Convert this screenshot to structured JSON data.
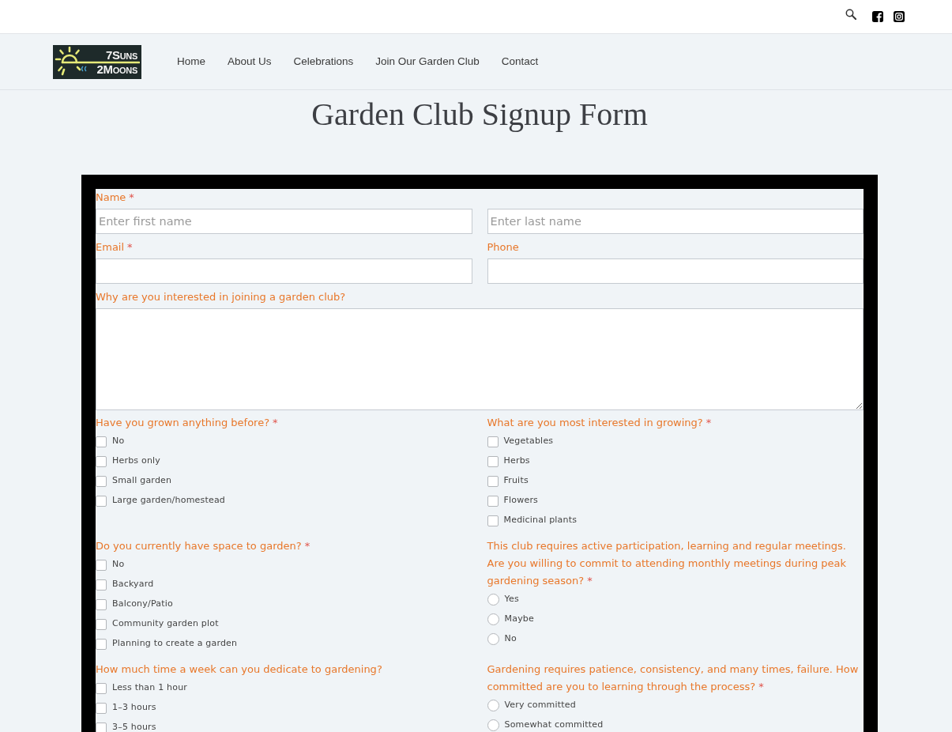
{
  "header": {
    "logo": {
      "line_1": "7Suns",
      "line_2": "2Moons"
    },
    "nav": [
      "Home",
      "About Us",
      "Celebrations",
      "Join Our Garden Club",
      "Contact"
    ]
  },
  "page_title": "Garden Club Signup Form",
  "form": {
    "rows": [
      {
        "columns": [
          {
            "kind": "text",
            "label": "Name",
            "required_mark": "*",
            "placeholder": "Enter first name"
          },
          {
            "kind": "text",
            "placeholder": "Enter last name"
          }
        ]
      },
      {
        "columns": [
          {
            "kind": "text",
            "label": "Email",
            "required_mark": "*"
          },
          {
            "kind": "text",
            "label": "Phone"
          }
        ]
      },
      {
        "columns": [
          {
            "kind": "textarea",
            "label": "Why are you interested in joining a garden club?"
          }
        ]
      },
      {
        "columns": [
          {
            "kind": "checkboxes",
            "label": "Have you grown anything before?",
            "required_mark": "*",
            "options": [
              {
                "label": "No",
                "checked": false
              },
              {
                "label": "Herbs only",
                "checked": false
              },
              {
                "label": "Small garden",
                "checked": false
              },
              {
                "label": "Large garden/homestead",
                "checked": false
              }
            ]
          },
          {
            "kind": "checkboxes",
            "label": "What are you most interested in growing?",
            "required_mark": "*",
            "options": [
              {
                "label": "Vegetables",
                "checked": false
              },
              {
                "label": "Herbs",
                "checked": false
              },
              {
                "label": "Fruits",
                "checked": false
              },
              {
                "label": "Flowers",
                "checked": false
              },
              {
                "label": "Medicinal plants",
                "checked": false
              }
            ]
          }
        ]
      },
      {
        "columns": [
          {
            "kind": "checkboxes",
            "label": "Do you currently have space to garden?",
            "required_mark": "*",
            "options": [
              {
                "label": "No",
                "checked": false
              },
              {
                "label": "Backyard",
                "checked": false
              },
              {
                "label": "Balcony/Patio",
                "checked": false
              },
              {
                "label": "Community garden plot",
                "checked": false
              },
              {
                "label": "Planning to create a garden",
                "checked": false
              }
            ]
          },
          {
            "kind": "radios",
            "label": "This club requires active participation, learning and regular meetings. Are you willing to commit to attending monthly meetings during peak gardening season?",
            "required_mark": "*",
            "options": [
              {
                "label": "Yes",
                "selected": false
              },
              {
                "label": "Maybe",
                "selected": false
              },
              {
                "label": "No",
                "selected": false
              }
            ]
          }
        ]
      },
      {
        "columns": [
          {
            "kind": "checkboxes",
            "label": "How much time a week can you dedicate to gardening?",
            "options": [
              {
                "label": "Less than 1 hour",
                "checked": false
              },
              {
                "label": "1–3 hours",
                "checked": false
              },
              {
                "label": "3–5 hours",
                "checked": false
              }
            ]
          },
          {
            "kind": "radios",
            "label": "Gardening requires patience, consistency, and many times, failure. How committed are you to learning through the process?",
            "required_mark": "*",
            "options": [
              {
                "label": "Very committed",
                "selected": false
              },
              {
                "label": "Somewhat committed",
                "selected": false
              }
            ]
          }
        ]
      }
    ]
  }
}
